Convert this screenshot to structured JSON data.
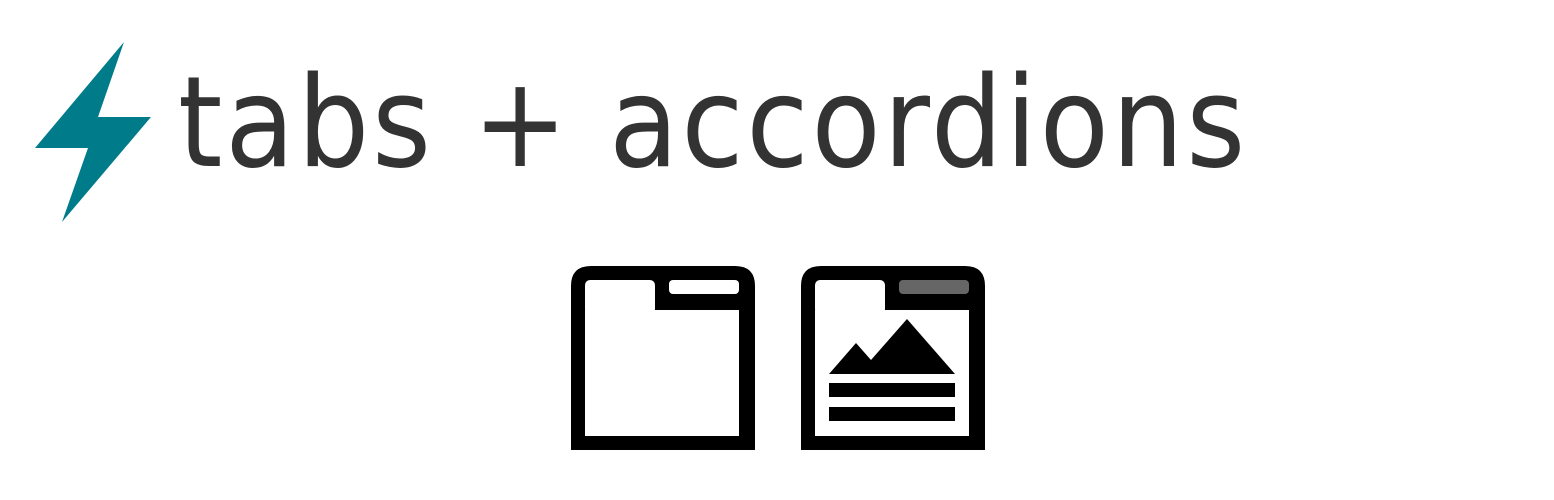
{
  "header": {
    "logo_icon": "lightning-bolt-icon",
    "title": "tabs + accordions",
    "accent_color": "#007b8a",
    "text_color": "#333333"
  },
  "icons": [
    {
      "name": "tab-panel-icon"
    },
    {
      "name": "accordion-panel-icon"
    }
  ]
}
